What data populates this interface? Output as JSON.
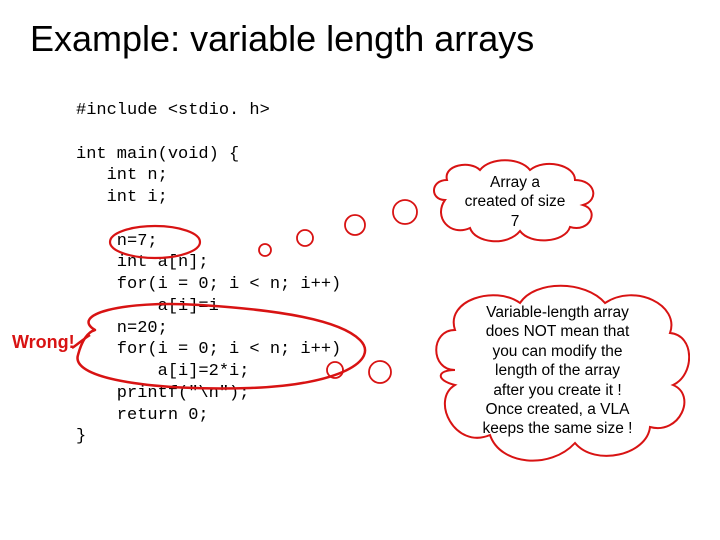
{
  "title": "Example: variable length arrays",
  "code": {
    "l1": "#include <stdio. h>",
    "l2": "",
    "l3": "int main(void) {",
    "l4": "   int n;",
    "l5": "   int i;",
    "l6": "",
    "l7": "    n=7;",
    "l8": "    int a[n];",
    "l9": "    for(i = 0; i < n; i++)",
    "l10": "        a[i]=i",
    "l11": "    n=20;",
    "l12": "    for(i = 0; i < n; i++)",
    "l13": "        a[i]=2*i;",
    "l14": "    printf(\"\\n\");",
    "l15": "    return 0;",
    "l16": "}"
  },
  "wrong_label": "Wrong!",
  "bubble1": {
    "line1": "Array a",
    "line2": "created of size",
    "line3": "7"
  },
  "bubble2": {
    "line1": "Variable-length array",
    "line2": "does NOT mean that",
    "line3": "you can modify the",
    "line4": "length of the array",
    "line5": "after you create it !",
    "line6": "Once created, a VLA",
    "line7": "keeps the same size !"
  }
}
